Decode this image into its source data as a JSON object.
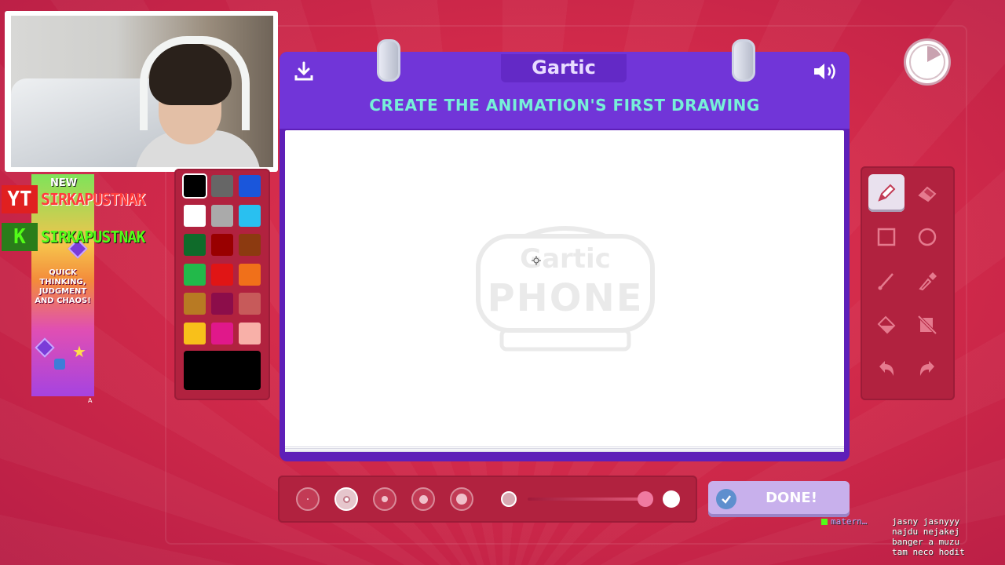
{
  "game": {
    "logo": "Gartic",
    "instruction": "CREATE THE ANIMATION'S FIRST DRAWING",
    "done_label": "DONE!",
    "watermark_logo": "Gartic PHONE"
  },
  "palette": {
    "colors": [
      "#000000",
      "#666666",
      "#1a56db",
      "#ffffff",
      "#aaaaaa",
      "#29c0f0",
      "#0f6b2a",
      "#990000",
      "#8c3a10",
      "#22b94a",
      "#e01515",
      "#f0701a",
      "#b87a23",
      "#8c0d4a",
      "#c75a5a",
      "#f8c01a",
      "#e0188a",
      "#f8b0a8"
    ],
    "selected_index": 0,
    "current_color": "#000000"
  },
  "tools": {
    "items": [
      "pencil",
      "eraser",
      "rectangle",
      "ellipse",
      "line",
      "eyedropper",
      "fill",
      "clear",
      "undo",
      "redo"
    ],
    "active": "pencil"
  },
  "brush": {
    "sizes": 5,
    "selected_size_index": 1,
    "opacity_percent": 100
  },
  "overlay": {
    "promo_new": "NEW",
    "promo_tagline": "QUICK THINKING, JUDGMENT AND CHAOS!",
    "promo_marker": "A",
    "youtube_icon": "YT",
    "youtube_handle": "SIRKAPUSTNAK",
    "kick_icon": "K",
    "kick_handle": "SIRKAPUSTNAK"
  },
  "chat": {
    "username": "matern…",
    "lines": [
      "jasny jasnyyy",
      "najdu nejakej",
      "banger a muzu",
      "tam neco hodit"
    ]
  }
}
